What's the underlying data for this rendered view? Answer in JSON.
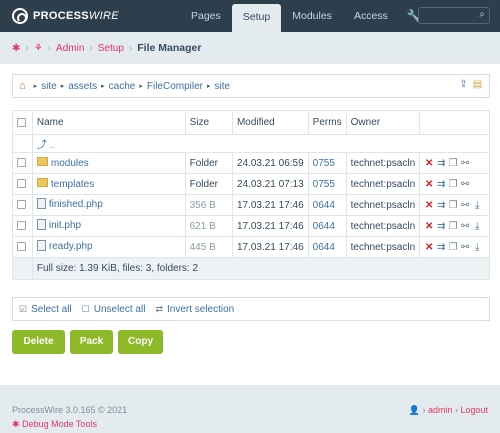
{
  "brand": {
    "bold": "PROCESS",
    "italic": "WIRE"
  },
  "nav": {
    "items": [
      "Pages",
      "Setup",
      "Modules",
      "Access"
    ],
    "active": "Setup"
  },
  "breadcrumb": {
    "items": [
      "Admin",
      "Setup"
    ],
    "current": "File Manager"
  },
  "path": [
    "site",
    "assets",
    "cache",
    "FileCompiler",
    "site"
  ],
  "table": {
    "headers": [
      "Name",
      "Size",
      "Modified",
      "Perms",
      "Owner"
    ],
    "parent_label": "..",
    "rows": [
      {
        "name": "modules",
        "type": "folder",
        "size": "Folder",
        "modified": "24.03.21 06:59",
        "perms": "0755",
        "owner": "technet:psacln"
      },
      {
        "name": "templates",
        "type": "folder",
        "size": "Folder",
        "modified": "24.03.21 07:13",
        "perms": "0755",
        "owner": "technet:psacln"
      },
      {
        "name": "finished.php",
        "type": "file",
        "size": "356 B",
        "modified": "17.03.21 17:46",
        "perms": "0644",
        "owner": "technet:psacln"
      },
      {
        "name": "init.php",
        "type": "file",
        "size": "621 B",
        "modified": "17.03.21 17:46",
        "perms": "0644",
        "owner": "technet:psacln"
      },
      {
        "name": "ready.php",
        "type": "file",
        "size": "445 B",
        "modified": "17.03.21 17:46",
        "perms": "0644",
        "owner": "technet:psacln"
      }
    ],
    "summary": "Full size: 1.39 KiB, files: 3, folders: 2"
  },
  "select": {
    "all": "Select all",
    "none": "Unselect all",
    "invert": "Invert selection"
  },
  "buttons": {
    "delete": "Delete",
    "pack": "Pack",
    "copy": "Copy"
  },
  "footer": {
    "version": "ProcessWire 3.0.165 © 2021",
    "debug": "Debug Mode Tools",
    "user": "admin",
    "logout": "Logout"
  },
  "colors": {
    "topbar": "#2d3e4c",
    "accent": "#e83561",
    "button": "#8eb928",
    "link": "#3b72a6"
  }
}
